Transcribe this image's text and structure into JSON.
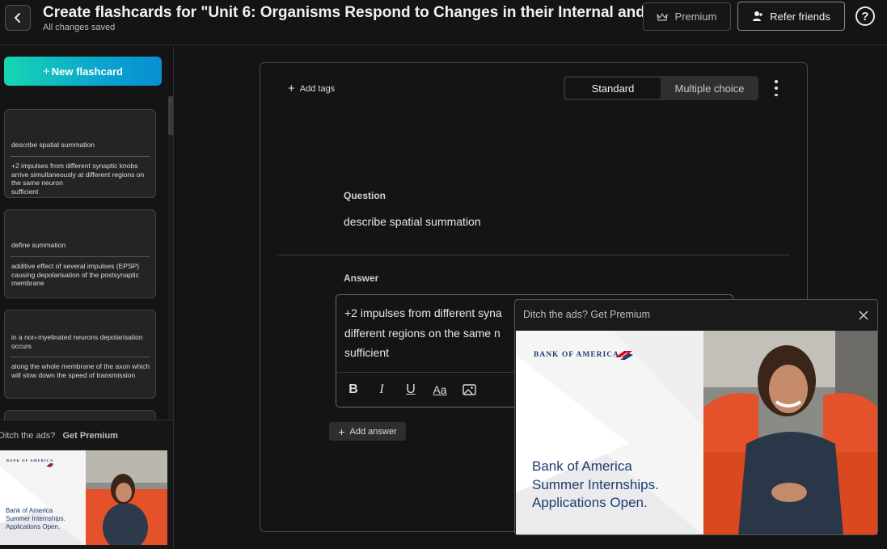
{
  "header": {
    "title": "Create flashcards for \"Unit 6: Organisms Respond to Changes in their Internal and ...",
    "subtitle": "All changes saved",
    "premium_label": "Premium",
    "refer_label": "Refer friends",
    "help_label": "?"
  },
  "sidebar": {
    "new_flashcard_label": "New flashcard",
    "cards": [
      {
        "question": "describe spatial summation",
        "answer": "+2 impulses from different synaptic knobs arrive simultaneously at different regions on the same neuron\nsufficient"
      },
      {
        "question": "define summation",
        "answer": "additive effect of several impulses (EPSP) causing depolarisation of the postsynaptic membrane"
      },
      {
        "question": "in a non-myelinated neurons depolarisation occurs",
        "answer": "along the whole membrane of the axon which will slow down the speed of transmission"
      }
    ],
    "ad": {
      "prompt": "Ditch the ads?",
      "link": "Get Premium",
      "brand": "BANK OF AMERICA",
      "copy_1": "Bank of America",
      "copy_2": "Summer Internships.",
      "copy_3": "Applications Open."
    }
  },
  "editor": {
    "add_tags_label": "Add tags",
    "mode_standard": "Standard",
    "mode_multiple_choice": "Multiple choice",
    "active_mode": "Standard",
    "question_label": "Question",
    "question_text": "describe spatial summation",
    "answer_label": "Answer",
    "answer_line_1": "+2 impulses from different syna",
    "answer_line_2": "different regions on the same n",
    "answer_line_3": "sufficient",
    "add_answer_label": "Add answer"
  },
  "float_ad": {
    "prompt": "Ditch the ads?",
    "link": "Get Premium",
    "brand": "BANK OF AMERICA",
    "copy_1": "Bank of America",
    "copy_2": "Summer Internships.",
    "copy_3": "Applications Open."
  },
  "colors": {
    "background": "#141414",
    "accent_gradient_start": "#17d6b0",
    "accent_gradient_end": "#078fd3",
    "boa_blue": "#1d3c6f",
    "boa_red": "#d4001a",
    "chair_orange": "#e3522a"
  }
}
